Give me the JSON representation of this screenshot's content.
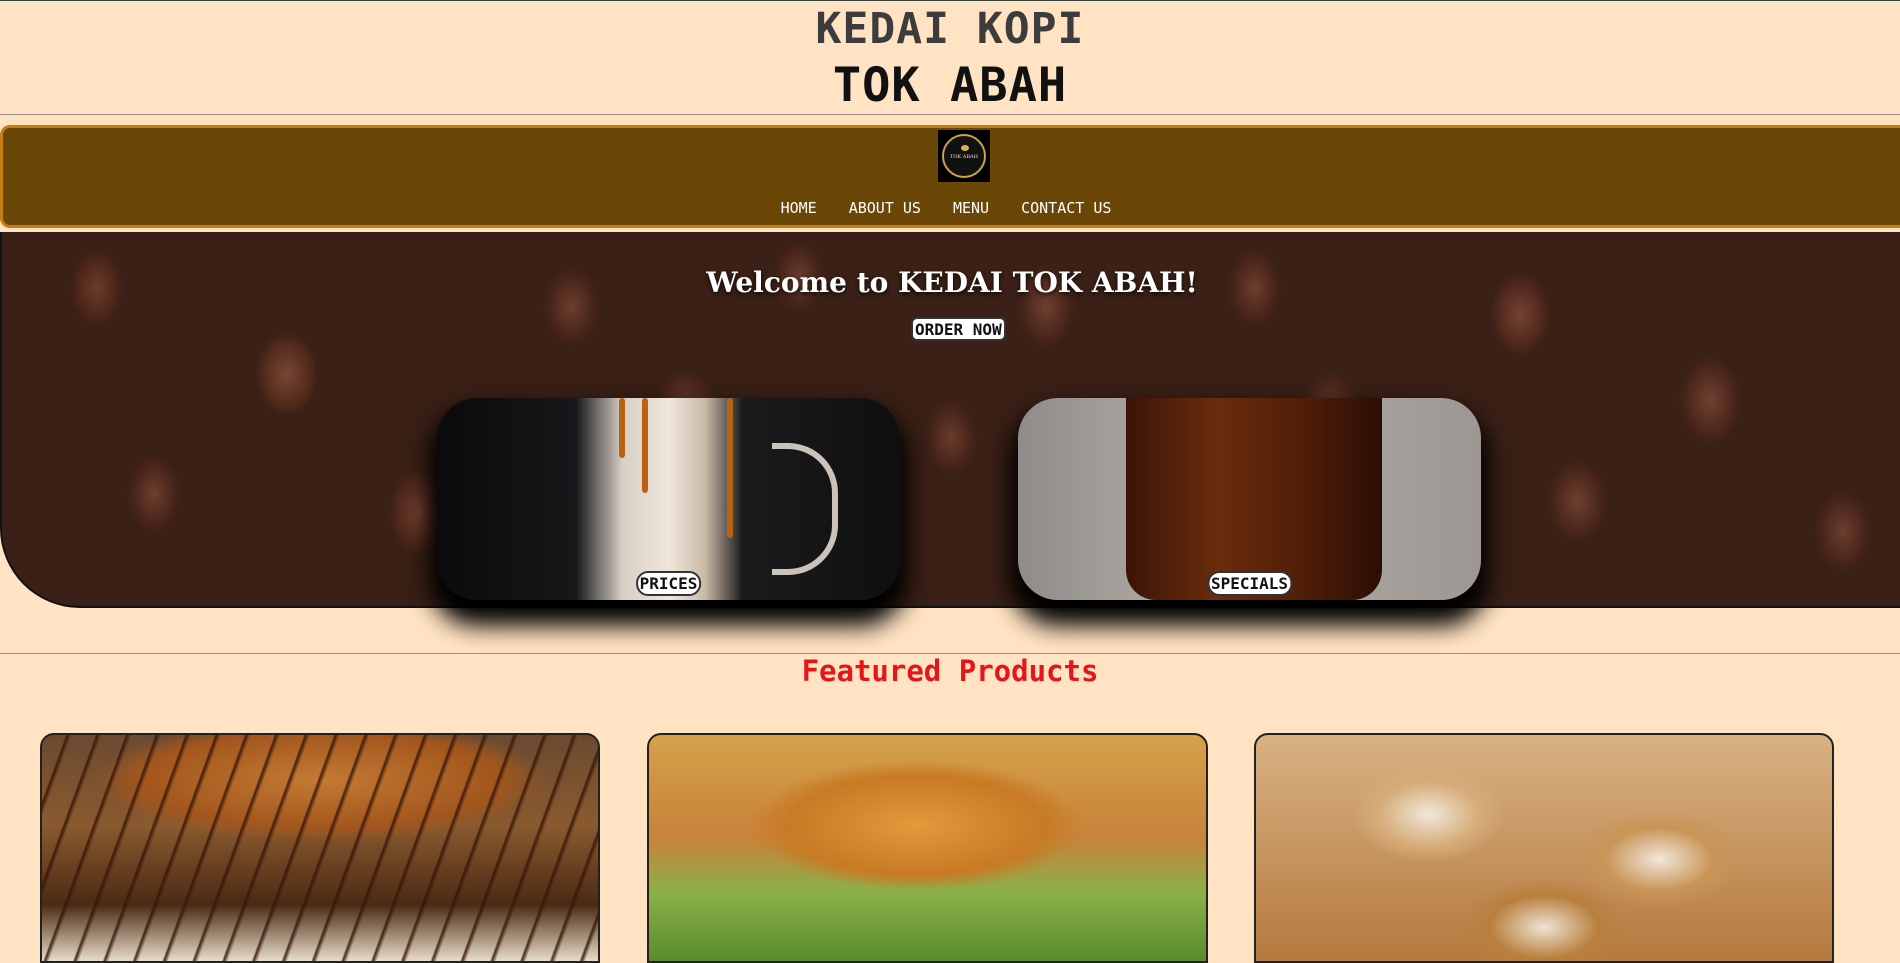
{
  "header": {
    "title_line1": "KEDAI KOPI",
    "title_line2": "TOK ABAH"
  },
  "navbar": {
    "logo_text": "TOK ABAH",
    "links": [
      "HOME",
      "ABOUT US",
      "MENU",
      "CONTACT US"
    ]
  },
  "hero": {
    "welcome": "Welcome to KEDAI TOK ABAH!",
    "order_button": "ORDER NOW",
    "cards": [
      {
        "button": "PRICES"
      },
      {
        "button": "SPECIALS"
      }
    ]
  },
  "featured": {
    "heading": "Featured Products"
  },
  "colors": {
    "background": "#ffe3c2",
    "navbar": "#6a4607",
    "navbar_border": "#c77c0f",
    "featured_heading": "#e5161a"
  }
}
